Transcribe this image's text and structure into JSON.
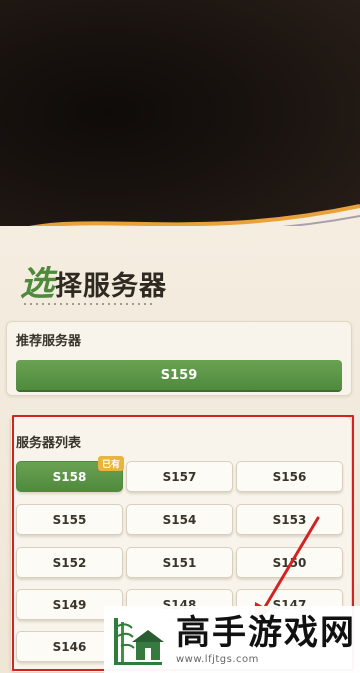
{
  "screen": {
    "title_first_char": "选",
    "title_rest": "择服务器",
    "recommended": {
      "label": "推荐服务器",
      "server": "S159"
    },
    "list": {
      "label": "服务器列表",
      "current_tag": "已有",
      "servers": [
        "S158",
        "S157",
        "S156",
        "S155",
        "S154",
        "S153",
        "S152",
        "S151",
        "S150",
        "S149",
        "S148",
        "S147",
        "S146"
      ],
      "selected_index": 0
    }
  },
  "watermark": {
    "brand": "高手游戏网",
    "url": "www.lfjtgs.com"
  },
  "colors": {
    "accent": "#4f8a3d",
    "tag": "#e7b53b",
    "annotation": "#d32222",
    "panel": "#f4ede0"
  }
}
